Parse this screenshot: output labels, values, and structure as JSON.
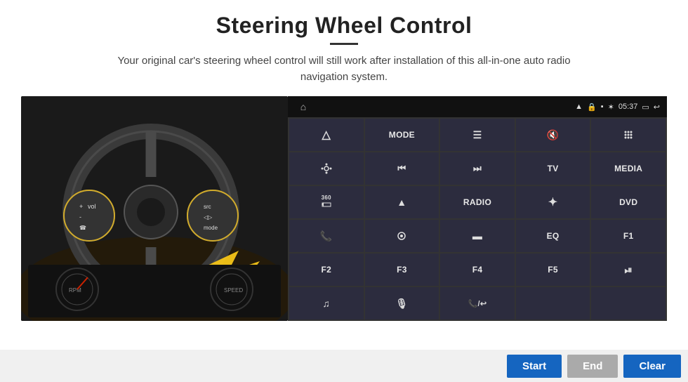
{
  "header": {
    "title": "Steering Wheel Control",
    "divider": true,
    "subtitle": "Your original car's steering wheel control will still work after installation of this all-in-one auto radio navigation system."
  },
  "status_bar": {
    "time": "05:37",
    "icons": [
      "wifi",
      "lock",
      "sim",
      "bluetooth",
      "battery",
      "screen",
      "back"
    ]
  },
  "grid_buttons": [
    {
      "id": "r0c0",
      "type": "icon",
      "symbol": "⌂",
      "label": "navigate"
    },
    {
      "id": "r0c1",
      "type": "text",
      "symbol": "MODE",
      "label": "mode"
    },
    {
      "id": "r0c2",
      "type": "icon",
      "symbol": "≡",
      "label": "menu"
    },
    {
      "id": "r0c3",
      "type": "icon",
      "symbol": "🔇",
      "label": "mute"
    },
    {
      "id": "r0c4",
      "type": "icon",
      "symbol": "⠿",
      "label": "apps"
    },
    {
      "id": "r1c0",
      "type": "icon",
      "symbol": "⚙",
      "label": "settings"
    },
    {
      "id": "r1c1",
      "type": "icon",
      "symbol": "⏮",
      "label": "prev"
    },
    {
      "id": "r1c2",
      "type": "icon",
      "symbol": "⏭",
      "label": "next"
    },
    {
      "id": "r1c3",
      "type": "text",
      "symbol": "TV",
      "label": "tv"
    },
    {
      "id": "r1c4",
      "type": "text",
      "symbol": "MEDIA",
      "label": "media"
    },
    {
      "id": "r2c0",
      "type": "icon",
      "symbol": "360",
      "label": "360cam"
    },
    {
      "id": "r2c1",
      "type": "icon",
      "symbol": "▲",
      "label": "eject"
    },
    {
      "id": "r2c2",
      "type": "text",
      "symbol": "RADIO",
      "label": "radio"
    },
    {
      "id": "r2c3",
      "type": "icon",
      "symbol": "☀",
      "label": "brightness"
    },
    {
      "id": "r2c4",
      "type": "text",
      "symbol": "DVD",
      "label": "dvd"
    },
    {
      "id": "r3c0",
      "type": "icon",
      "symbol": "📞",
      "label": "phone"
    },
    {
      "id": "r3c1",
      "type": "icon",
      "symbol": "◎",
      "label": "navi"
    },
    {
      "id": "r3c2",
      "type": "icon",
      "symbol": "▬",
      "label": "mirror"
    },
    {
      "id": "r3c3",
      "type": "text",
      "symbol": "EQ",
      "label": "eq"
    },
    {
      "id": "r3c4",
      "type": "text",
      "symbol": "F1",
      "label": "f1"
    },
    {
      "id": "r4c0",
      "type": "text",
      "symbol": "F2",
      "label": "f2"
    },
    {
      "id": "r4c1",
      "type": "text",
      "symbol": "F3",
      "label": "f3"
    },
    {
      "id": "r4c2",
      "type": "text",
      "symbol": "F4",
      "label": "f4"
    },
    {
      "id": "r4c3",
      "type": "text",
      "symbol": "F5",
      "label": "f5"
    },
    {
      "id": "r4c4",
      "type": "icon",
      "symbol": "⏯",
      "label": "play-pause"
    },
    {
      "id": "r5c0",
      "type": "icon",
      "symbol": "♫",
      "label": "music"
    },
    {
      "id": "r5c1",
      "type": "icon",
      "symbol": "🎤",
      "label": "mic"
    },
    {
      "id": "r5c2",
      "type": "icon",
      "symbol": "📞✕",
      "label": "hangup"
    },
    {
      "id": "r5c3",
      "type": "empty",
      "symbol": "",
      "label": "empty1"
    },
    {
      "id": "r5c4",
      "type": "empty",
      "symbol": "",
      "label": "empty2"
    }
  ],
  "bottom": {
    "start_label": "Start",
    "end_label": "End",
    "clear_label": "Clear"
  }
}
